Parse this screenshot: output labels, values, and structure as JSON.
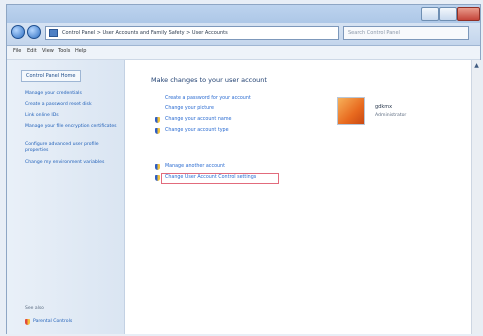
{
  "window": {
    "address_text": "Control Panel > User Accounts and Family Safety > User Accounts",
    "search_placeholder": "Search Control Panel"
  },
  "menu": [
    "File",
    "Edit",
    "View",
    "Tools",
    "Help"
  ],
  "sidebar": {
    "home": "Control Panel Home",
    "links": [
      "Manage your credentials",
      "Create a password reset disk",
      "Link online IDs",
      "Manage your file encryption certificates",
      "Configure advanced user profile properties",
      "Change my environment variables"
    ],
    "see_also": "See also",
    "parental": "Parental Controls"
  },
  "main": {
    "title": "Make changes to your user account",
    "tasks": [
      {
        "label": "Create a password for your account",
        "icon": "none"
      },
      {
        "label": "Change your picture",
        "icon": "none"
      },
      {
        "label": "Change your account name",
        "icon": "shield-icon"
      },
      {
        "label": "Change your account type",
        "icon": "shield-icon"
      },
      {
        "label": "Manage another account",
        "icon": "shield-icon"
      },
      {
        "label": "Change User Account Control settings",
        "icon": "shield-icon"
      }
    ],
    "user": {
      "name": "gdkmx",
      "role": "Administrator"
    }
  },
  "colors": {
    "link": "#2a6bd1",
    "title": "#1f3f70",
    "highlight": "#e26b7c"
  }
}
